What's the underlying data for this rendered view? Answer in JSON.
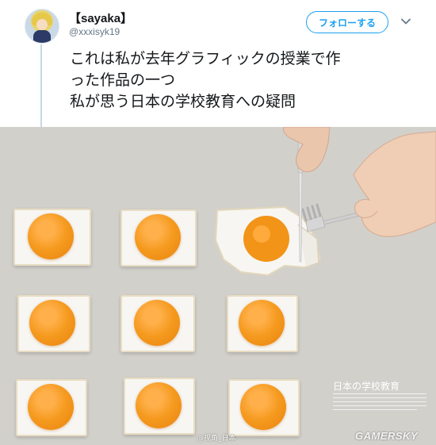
{
  "tweet": {
    "display_name": "【sayaka】",
    "handle": "@xxxisyk19",
    "follow_label": "フォローする",
    "text_lines": [
      "これは私が去年グラフィックの授業で作",
      "った作品の一つ",
      "私が思う日本の学校教育への疑問"
    ]
  },
  "photo": {
    "article_title": "日本の学校教育",
    "credit": "@视角_日本",
    "watermark": "GAMERSKY"
  },
  "colors": {
    "accent": "#1da1f2",
    "background_photo": "#d2d0cb",
    "yolk": "#f59a1f"
  }
}
